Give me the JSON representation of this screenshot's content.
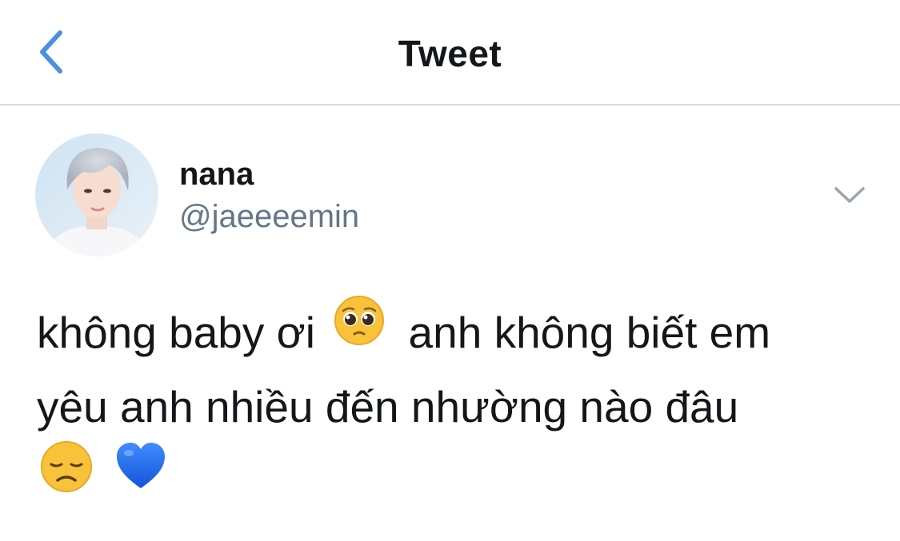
{
  "nav": {
    "title": "Tweet",
    "back_icon": "chevron-left-icon",
    "accent_color": "#4a90e2"
  },
  "tweet": {
    "author": {
      "display_name": "nana",
      "handle": "@jaeeeemin",
      "avatar_icon": "profile-photo"
    },
    "menu_icon": "chevron-down-icon",
    "text": {
      "line1_part1": "không baby ơi",
      "line1_emoji": "pleading-face-emoji",
      "line1_part2": "anh không biết em",
      "line2": "yêu anh nhiều đến nhường nào đâu",
      "line3_emojis": [
        "disappointed-face-emoji",
        "blue-heart-emoji"
      ]
    }
  },
  "colors": {
    "text_primary": "#14171a",
    "text_secondary": "#657786",
    "divider": "#d6d9dc",
    "blue_heart": "#1d6cf0",
    "emoji_face": "#f8c23a"
  }
}
